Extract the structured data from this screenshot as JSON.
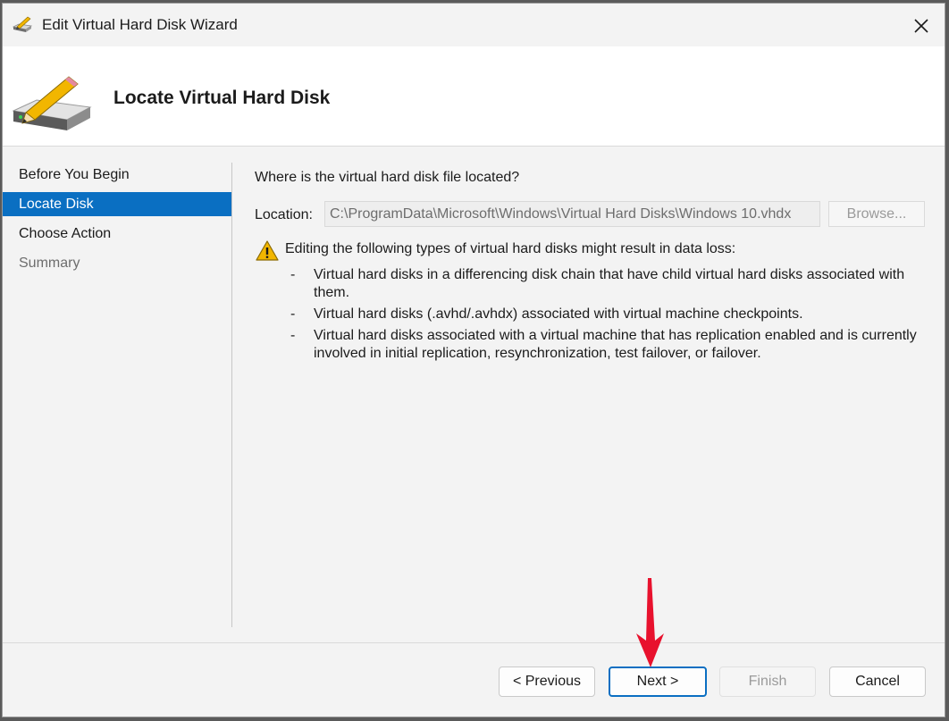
{
  "window": {
    "title": "Edit Virtual Hard Disk Wizard"
  },
  "header": {
    "title": "Locate Virtual Hard Disk"
  },
  "nav": {
    "items": [
      {
        "label": "Before You Begin"
      },
      {
        "label": "Locate Disk"
      },
      {
        "label": "Choose Action"
      },
      {
        "label": "Summary"
      }
    ]
  },
  "content": {
    "question": "Where is the virtual hard disk file located?",
    "location_label": "Location:",
    "location_value": "C:\\ProgramData\\Microsoft\\Windows\\Virtual Hard Disks\\Windows 10.vhdx",
    "browse_label": "Browse...",
    "warning_text": "Editing the following types of virtual hard disks might result in data loss:",
    "bullets": [
      "Virtual hard disks in a differencing disk chain that have child virtual hard disks associated with them.",
      "Virtual hard disks (.avhd/.avhdx) associated with virtual machine checkpoints.",
      "Virtual hard disks associated with a virtual machine that has replication enabled and is currently involved in initial replication, resynchronization, test failover, or failover."
    ],
    "bullet_marker": "-"
  },
  "footer": {
    "previous_label": "< Previous",
    "next_label": "Next >",
    "finish_label": "Finish",
    "cancel_label": "Cancel"
  },
  "colors": {
    "accent": "#0a6fc2",
    "annotation_arrow": "#e8112d",
    "warning": "#f2b600"
  }
}
